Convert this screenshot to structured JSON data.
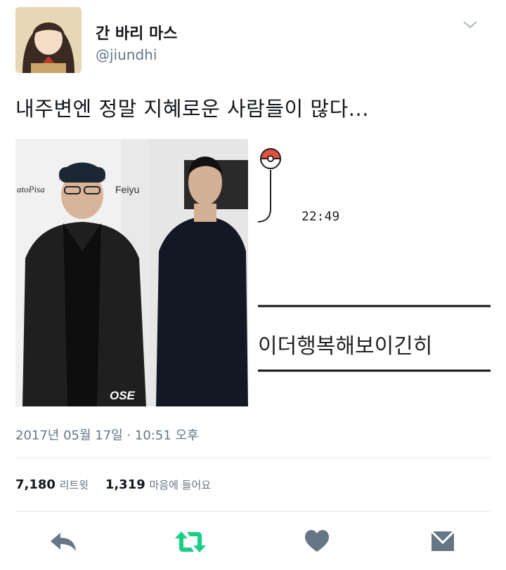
{
  "user": {
    "display_name": "간 바리 마스",
    "handle": "@jiundhi"
  },
  "tweet": {
    "text": "내주변엔 정말 지혜로운 사람들이 많다...",
    "timestamp": "2017년 05월 17일 · 10:51 오후"
  },
  "media": {
    "photo_a_text": "atoPisa",
    "photo_a_brand": "Feiyu",
    "photo_a_watermark": "OSE",
    "chat_time": "22:49",
    "chat_text": "이더행복해보이긴히"
  },
  "stats": {
    "retweets_count": "7,180",
    "retweets_label": "리트윗",
    "likes_count": "1,319",
    "likes_label": "마음에 들어요"
  },
  "colors": {
    "retweet_green": "#19cf86",
    "icon_gray": "#657786",
    "divider": "#e1e8ed"
  },
  "icons": [
    "chevron-down-icon",
    "reply-icon",
    "retweet-icon",
    "heart-icon",
    "direct-message-icon"
  ]
}
